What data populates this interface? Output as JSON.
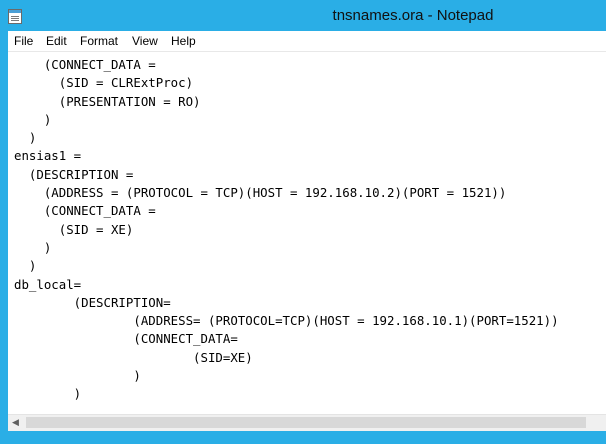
{
  "window": {
    "title": "tnsnames.ora - Notepad",
    "icon": "notepad-icon",
    "accent_color": "#2aaee6"
  },
  "menu": {
    "items": [
      {
        "label": "File"
      },
      {
        "label": "Edit"
      },
      {
        "label": "Format"
      },
      {
        "label": "View"
      },
      {
        "label": "Help"
      }
    ]
  },
  "editor": {
    "lines": [
      "    (CONNECT_DATA =",
      "      (SID = CLRExtProc)",
      "      (PRESENTATION = RO)",
      "    )",
      "  )",
      "ensias1 =",
      "  (DESCRIPTION =",
      "    (ADDRESS = (PROTOCOL = TCP)(HOST = 192.168.10.2)(PORT = 1521))",
      "    (CONNECT_DATA =",
      "      (SID = XE)",
      "    )",
      "  )",
      "db_local=",
      "\t(DESCRIPTION=",
      "\t\t(ADDRESS= (PROTOCOL=TCP)(HOST = 192.168.10.1)(PORT=1521))",
      "\t\t(CONNECT_DATA=",
      "\t\t\t(SID=XE)",
      "\t\t)",
      "\t)"
    ]
  },
  "scrollbar": {
    "left_arrow_icon": "chevron-left-icon"
  }
}
